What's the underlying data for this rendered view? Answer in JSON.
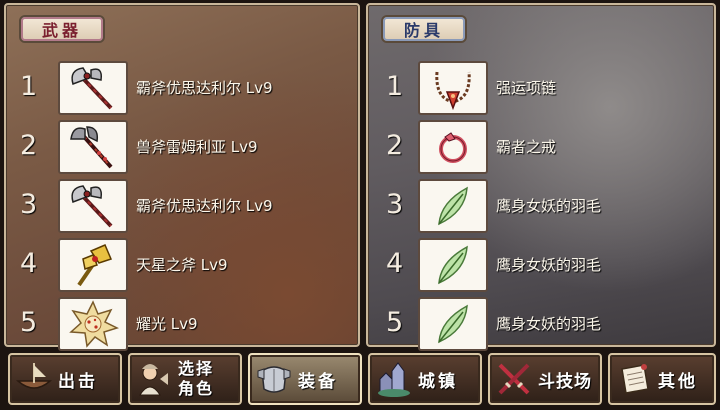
{
  "weapons": {
    "title": "武器",
    "items": [
      {
        "num": "1",
        "name": "霸斧优思达利尔 Lv9",
        "icon": "battle-axe-icon"
      },
      {
        "num": "2",
        "name": "兽斧雷姆利亚 Lv9",
        "icon": "beast-axe-icon"
      },
      {
        "num": "3",
        "name": "霸斧优思达利尔 Lv9",
        "icon": "battle-axe-icon"
      },
      {
        "num": "4",
        "name": "天星之斧 Lv9",
        "icon": "golden-axe-icon"
      },
      {
        "num": "5",
        "name": "耀光 Lv9",
        "icon": "radiant-orb-icon"
      }
    ]
  },
  "armor": {
    "title": "防具",
    "items": [
      {
        "num": "1",
        "name": "强运项链",
        "icon": "necklace-icon"
      },
      {
        "num": "2",
        "name": "霸者之戒",
        "icon": "ring-icon"
      },
      {
        "num": "3",
        "name": "鹰身女妖的羽毛",
        "icon": "feather-icon"
      },
      {
        "num": "4",
        "name": "鹰身女妖的羽毛",
        "icon": "feather-icon"
      },
      {
        "num": "5",
        "name": "鹰身女妖的羽毛",
        "icon": "feather-icon"
      }
    ]
  },
  "nav": {
    "sortie": "出击",
    "select_line1": "选择",
    "select_line2": "角色",
    "equip": "装备",
    "town": "城镇",
    "arena": "斗技场",
    "other": "其他",
    "active": "equip"
  }
}
